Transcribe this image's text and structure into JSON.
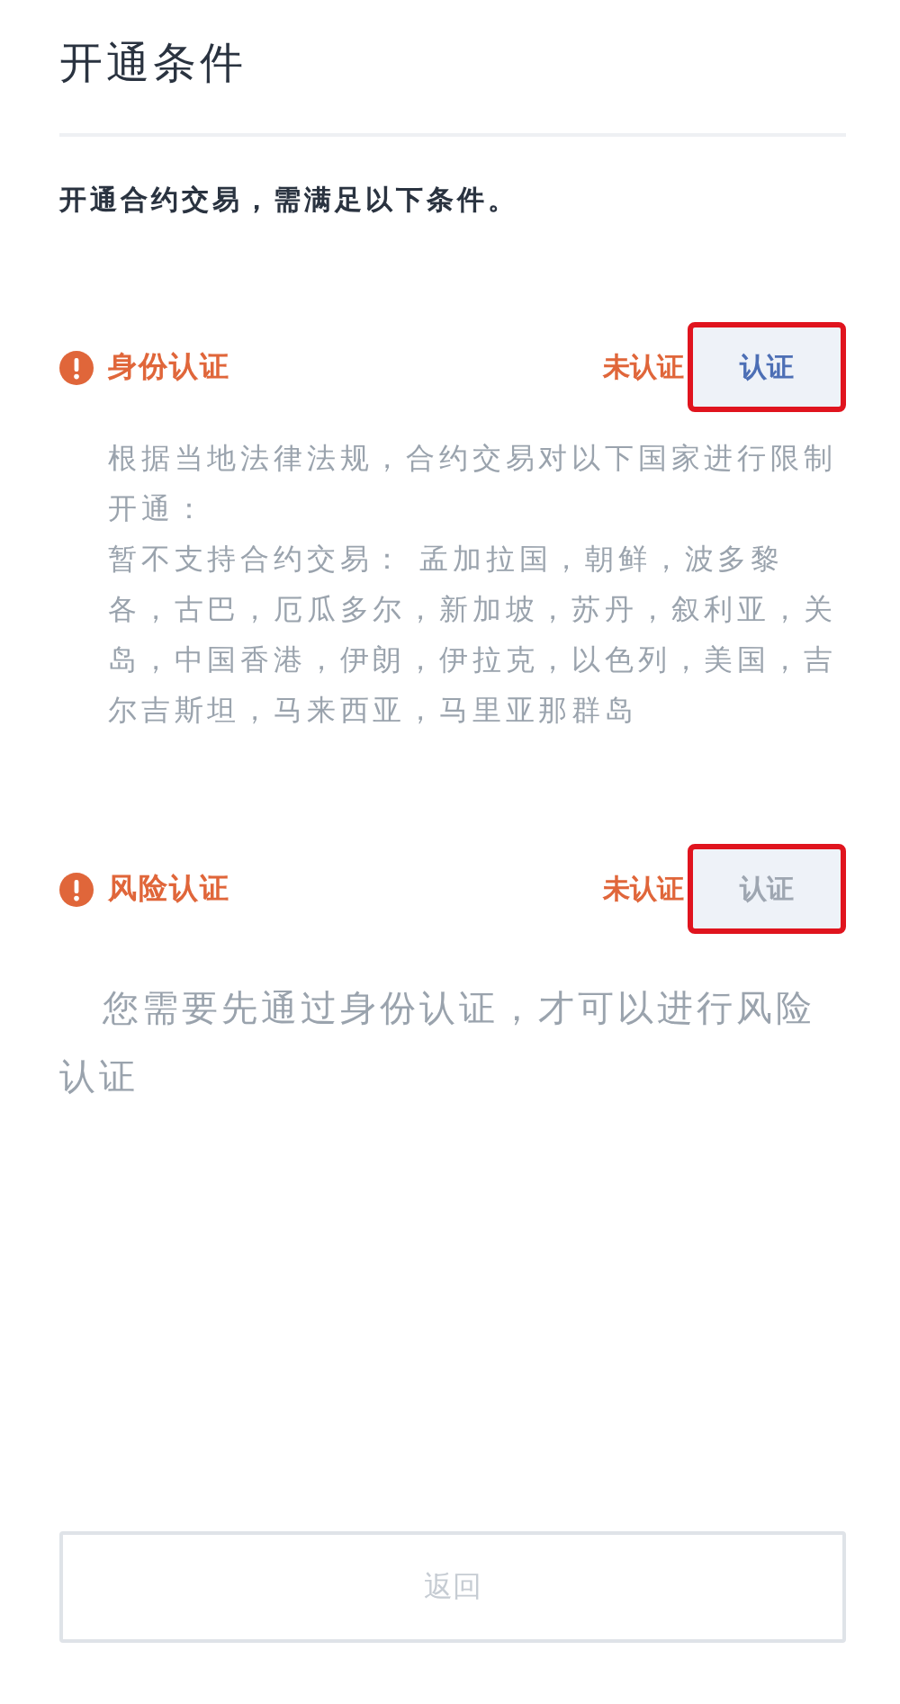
{
  "title": "开通条件",
  "intro": "开通合约交易，需满足以下条件。",
  "sections": [
    {
      "title": "身份认证",
      "status": "未认证",
      "button": {
        "label": "认证",
        "disabled": false,
        "highlighted": true
      },
      "paragraphs": [
        "根据当地法律法规，合约交易对以下国家进行限制开通：",
        "暂不支持合约交易： 孟加拉国，朝鲜，波多黎各，古巴，厄瓜多尔，新加坡，苏丹，叙利亚，关岛，中国香港，伊朗，伊拉克，以色列，美国，吉尔吉斯坦，马来西亚，马里亚那群岛"
      ],
      "kind": "list"
    },
    {
      "title": "风险认证",
      "status": "未认证",
      "button": {
        "label": "认证",
        "disabled": true,
        "highlighted": true
      },
      "paragraphs": [
        "您需要先通过身份认证，才可以进行风险认证"
      ],
      "kind": "note"
    }
  ],
  "back_button": {
    "label": "返回",
    "disabled": true
  }
}
